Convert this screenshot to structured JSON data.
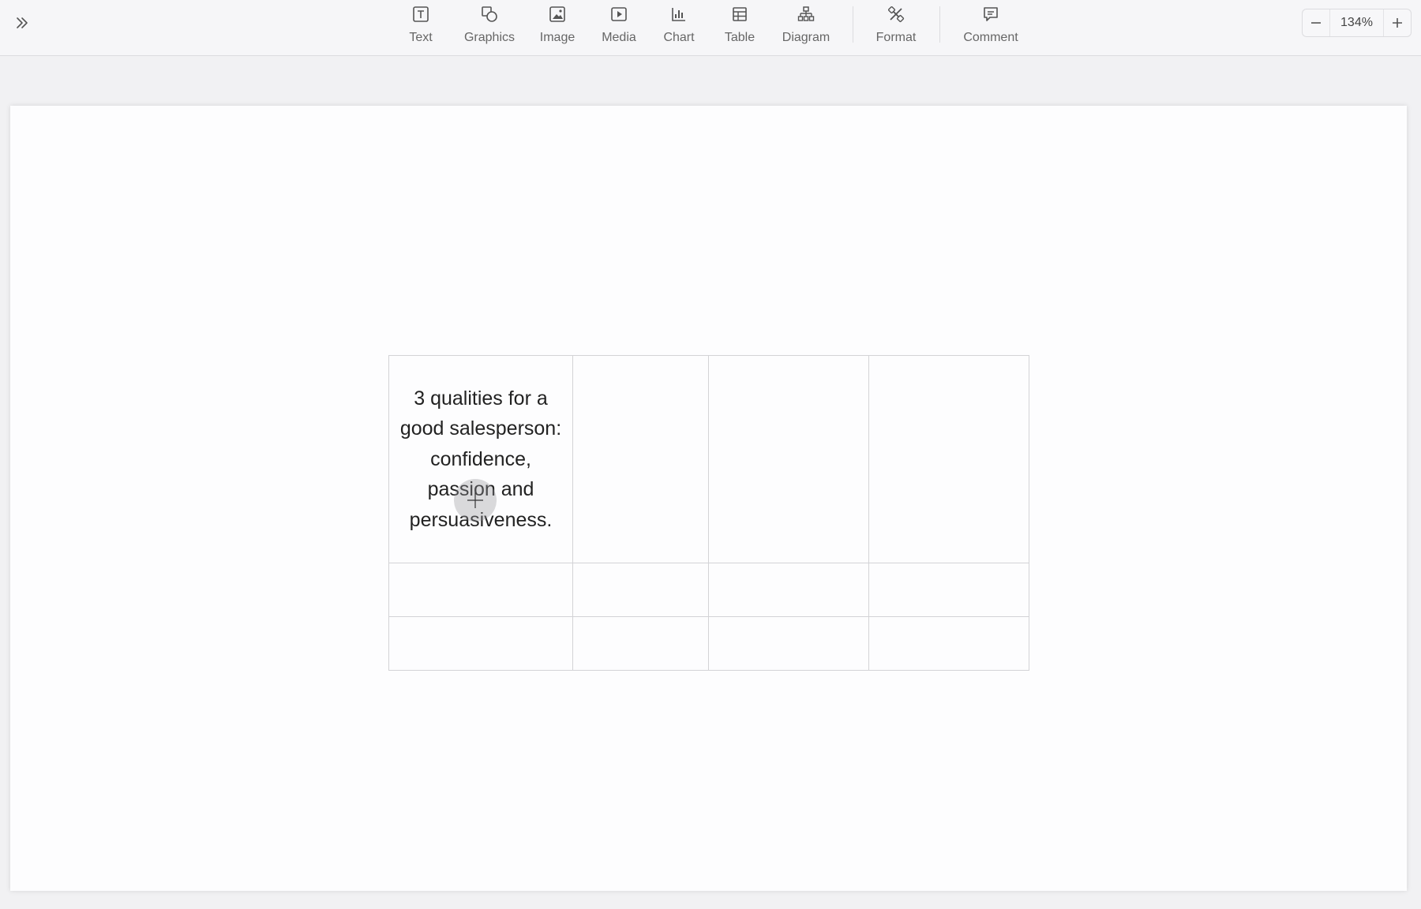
{
  "toolbar": {
    "tools": [
      {
        "label": "Text",
        "icon": "text-icon"
      },
      {
        "label": "Graphics",
        "icon": "graphics-icon"
      },
      {
        "label": "Image",
        "icon": "image-icon"
      },
      {
        "label": "Media",
        "icon": "media-icon"
      },
      {
        "label": "Chart",
        "icon": "chart-icon"
      },
      {
        "label": "Table",
        "icon": "table-icon"
      },
      {
        "label": "Diagram",
        "icon": "diagram-icon"
      },
      {
        "label": "Format",
        "icon": "format-icon"
      },
      {
        "label": "Comment",
        "icon": "comment-icon"
      }
    ]
  },
  "zoom": {
    "value": "134%"
  },
  "table": {
    "rows": [
      [
        "3 qualities for a good salesperson: confidence, passion and persuasiveness.",
        "",
        "",
        ""
      ],
      [
        "",
        "",
        "",
        ""
      ],
      [
        "",
        "",
        "",
        ""
      ]
    ]
  },
  "colors": {
    "border": "#d3d3d6",
    "icon": "#555555"
  }
}
